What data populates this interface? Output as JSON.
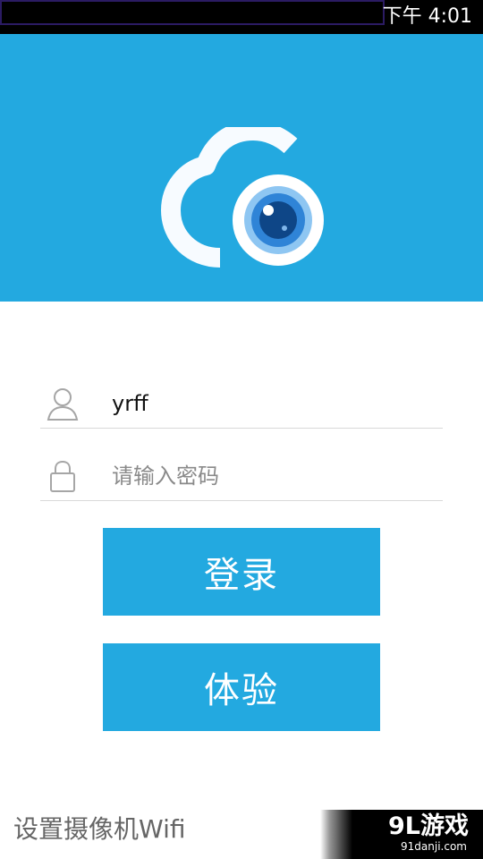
{
  "status_bar": {
    "time": "下午 4:01"
  },
  "header": {
    "logo_icon": "cloud-camera-logo",
    "background_color": "#23a9e0"
  },
  "login_form": {
    "username": {
      "icon": "user-icon",
      "value": "yrff"
    },
    "password": {
      "icon": "lock-icon",
      "placeholder": "请输入密码"
    }
  },
  "buttons": {
    "login_label": "登录",
    "demo_label": "体验"
  },
  "footer": {
    "wifi_link": "设置摄像机Wifi",
    "watermark_main": "9L游戏",
    "watermark_sub": "91danji.com"
  }
}
